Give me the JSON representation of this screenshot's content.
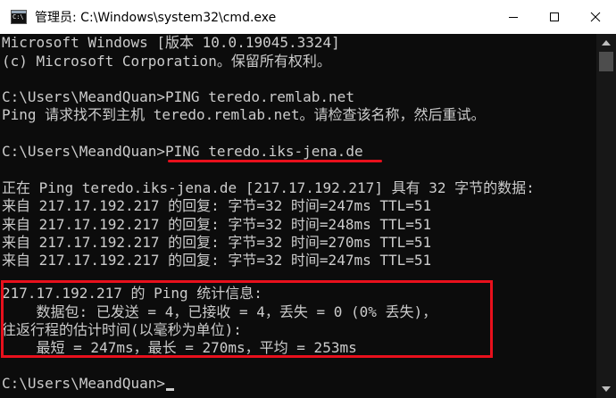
{
  "window": {
    "title": "管理员: C:\\Windows\\system32\\cmd.exe"
  },
  "console": {
    "lines": [
      "Microsoft Windows [版本 10.0.19045.3324]",
      "(c) Microsoft Corporation。保留所有权利。",
      "",
      "C:\\Users\\MeandQuan>PING teredo.remlab.net",
      "Ping 请求找不到主机 teredo.remlab.net。请检查该名称，然后重试。",
      "",
      "C:\\Users\\MeandQuan>PING teredo.iks-jena.de",
      "",
      "正在 Ping teredo.iks-jena.de [217.17.192.217] 具有 32 字节的数据:",
      "来自 217.17.192.217 的回复: 字节=32 时间=247ms TTL=51",
      "来自 217.17.192.217 的回复: 字节=32 时间=248ms TTL=51",
      "来自 217.17.192.217 的回复: 字节=32 时间=270ms TTL=51",
      "来自 217.17.192.217 的回复: 字节=32 时间=247ms TTL=51",
      "",
      "217.17.192.217 的 Ping 统计信息:",
      "    数据包: 已发送 = 4，已接收 = 4，丢失 = 0 (0% 丢失)，",
      "往返行程的估计时间(以毫秒为单位):",
      "    最短 = 247ms，最长 = 270ms，平均 = 253ms",
      "",
      "C:\\Users\\MeandQuan>"
    ]
  },
  "colors": {
    "background": "#0c0c0c",
    "text": "#cccccc",
    "highlight": "#e8101c"
  },
  "icons": [
    "cmd-app-icon",
    "minimize-icon",
    "maximize-icon",
    "close-icon",
    "scroll-up-icon",
    "scroll-down-icon"
  ]
}
